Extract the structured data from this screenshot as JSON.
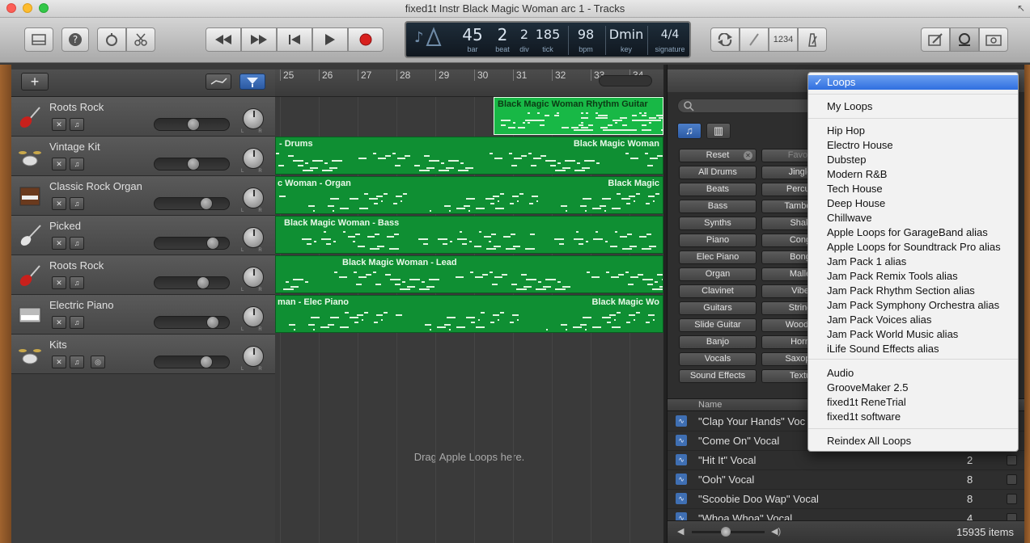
{
  "window": {
    "title": "fixed1t Instr Black Magic Woman arc 1 - Tracks",
    "fullscreen_icon": "↖"
  },
  "lcd": {
    "bar": {
      "value": "45",
      "label": "bar"
    },
    "beat": {
      "value": "2",
      "label": "beat"
    },
    "div": {
      "value": "2",
      "label": "div"
    },
    "tick": {
      "value": "185",
      "label": "tick"
    },
    "bpm": {
      "value": "98",
      "label": "bpm"
    },
    "key": {
      "value": "Dmin",
      "label": "key"
    },
    "signature": {
      "value": "4/4",
      "label": "signature"
    }
  },
  "toolbar": {
    "count_in_label": "1234"
  },
  "tracks": [
    {
      "name": "Roots Rock",
      "icon": "electric-guitar-icon"
    },
    {
      "name": "Vintage Kit",
      "icon": "drum-kit-icon"
    },
    {
      "name": "Classic Rock Organ",
      "icon": "organ-icon"
    },
    {
      "name": "Picked",
      "icon": "bass-guitar-icon"
    },
    {
      "name": "Roots Rock",
      "icon": "electric-guitar-icon"
    },
    {
      "name": "Electric Piano",
      "icon": "electric-piano-icon"
    },
    {
      "name": "Kits",
      "icon": "drum-kit-icon"
    }
  ],
  "ruler": {
    "bars": [
      "25",
      "26",
      "27",
      "28",
      "29",
      "30",
      "31",
      "32",
      "33",
      "34"
    ]
  },
  "regions": [
    {
      "title": "Black Magic Woman Rhythm Guitar",
      "title2": ""
    },
    {
      "title": "- Drums",
      "title2": "Black Magic Woman"
    },
    {
      "title": "c Woman - Organ",
      "title2": "Black Magic"
    },
    {
      "title": "Black Magic Woman - Bass",
      "title2": ""
    },
    {
      "title": "Black Magic Woman - Lead",
      "title2": ""
    },
    {
      "title": "man - Elec Piano",
      "title2": "Black Magic Wo"
    }
  ],
  "arrange": {
    "drag_hint": "Drag Apple Loops here."
  },
  "browser": {
    "reset_label": "Reset",
    "favorites_label": "Favori",
    "keywords_left": [
      "All Drums",
      "Beats",
      "Bass",
      "Synths",
      "Piano",
      "Elec Piano",
      "Organ",
      "Clavinet",
      "Guitars",
      "Slide Guitar",
      "Banjo",
      "Vocals",
      "Sound Effects"
    ],
    "keywords_right": [
      "Jingle",
      "Percus",
      "Tambou",
      "Shak",
      "Cong",
      "Bong",
      "Malle",
      "Vibe",
      "String",
      "Woodw",
      "Horn",
      "Saxoph",
      "Textu"
    ],
    "results_header_name": "Name",
    "results": [
      {
        "name": "\"Clap Your Hands\" Voc",
        "beats": ""
      },
      {
        "name": "\"Come On\" Vocal",
        "beats": ""
      },
      {
        "name": "\"Hit It\" Vocal",
        "beats": "2"
      },
      {
        "name": "\"Ooh\" Vocal",
        "beats": "8"
      },
      {
        "name": "\"Scoobie Doo Wap\" Vocal",
        "beats": "8"
      },
      {
        "name": "\"Whoa Whoa\" Vocal",
        "beats": "4"
      }
    ],
    "item_count": "15935 items"
  },
  "menu": {
    "checkmark": "✓",
    "items": [
      {
        "label": "Loops",
        "selected": true
      },
      {
        "label": "My Loops"
      },
      {
        "label": "Hip Hop"
      },
      {
        "label": "Electro House"
      },
      {
        "label": "Dubstep"
      },
      {
        "label": "Modern R&B"
      },
      {
        "label": "Tech House"
      },
      {
        "label": "Deep House"
      },
      {
        "label": "Chillwave"
      },
      {
        "label": "Apple Loops for GarageBand alias"
      },
      {
        "label": "Apple Loops for Soundtrack Pro alias"
      },
      {
        "label": "Jam Pack 1 alias"
      },
      {
        "label": "Jam Pack Remix Tools alias"
      },
      {
        "label": "Jam Pack Rhythm Section alias"
      },
      {
        "label": "Jam Pack Symphony Orchestra alias"
      },
      {
        "label": "Jam Pack Voices alias"
      },
      {
        "label": "Jam Pack World Music alias"
      },
      {
        "label": "iLife Sound Effects alias"
      },
      {
        "label": "Audio"
      },
      {
        "label": "GrooveMaker 2.5"
      },
      {
        "label": "fixed1t ReneTrial"
      },
      {
        "label": "fixed1t software"
      },
      {
        "label": "Reindex All Loops"
      }
    ]
  },
  "colors": {
    "region_green": "#0f8f33",
    "selected_region": "#18b846",
    "menu_highlight": "#2f6fe0"
  }
}
